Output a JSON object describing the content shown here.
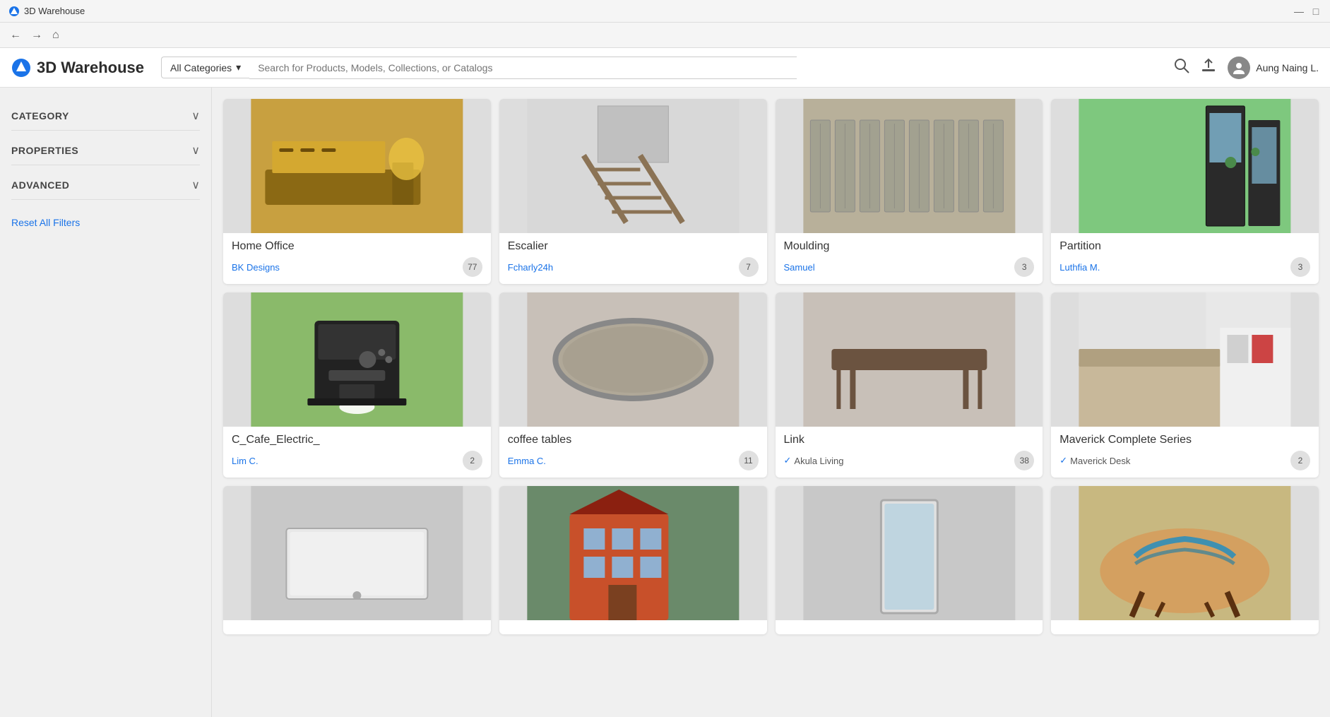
{
  "titleBar": {
    "title": "3D Warehouse",
    "minBtn": "—",
    "maxBtn": "□"
  },
  "nav": {
    "backBtn": "←",
    "forwardBtn": "→",
    "homeBtn": "⌂"
  },
  "header": {
    "logoText": "3D Warehouse",
    "categoryDropdown": "All Categories",
    "searchPlaceholder": "Search for Products, Models, Collections, or Catalogs",
    "userName": "Aung Naing L."
  },
  "sidebar": {
    "filters": [
      {
        "id": "category",
        "label": "CATEGORY"
      },
      {
        "id": "properties",
        "label": "PROPERTIES"
      },
      {
        "id": "advanced",
        "label": "ADVANCED"
      }
    ],
    "resetLabel": "Reset All Filters"
  },
  "grid": {
    "cards": [
      {
        "id": "home-office",
        "title": "Home Office",
        "author": "BK Designs",
        "count": "77",
        "verified": false,
        "verifiedText": "",
        "bgColor": "#c8a040",
        "imageType": "desk"
      },
      {
        "id": "escalier",
        "title": "Escalier",
        "author": "Fcharly24h",
        "count": "7",
        "verified": false,
        "verifiedText": "",
        "bgColor": "#d0d0d0",
        "imageType": "ladder"
      },
      {
        "id": "moulding",
        "title": "Moulding",
        "author": "Samuel",
        "count": "3",
        "verified": false,
        "verifiedText": "",
        "bgColor": "#b8b09a",
        "imageType": "moulding"
      },
      {
        "id": "partition",
        "title": "Partition",
        "author": "Luthfia M.",
        "count": "3",
        "verified": false,
        "verifiedText": "",
        "bgColor": "#7ec87e",
        "imageType": "partition"
      },
      {
        "id": "cafe-electric",
        "title": "C_Cafe_Electric_",
        "author": "Lim C.",
        "count": "2",
        "verified": false,
        "verifiedText": "",
        "bgColor": "#8aba6a",
        "imageType": "coffee-machine"
      },
      {
        "id": "coffee-tables",
        "title": "coffee tables",
        "author": "Emma C.",
        "count": "11",
        "verified": false,
        "verifiedText": "",
        "bgColor": "#c8c0b8",
        "imageType": "round-table"
      },
      {
        "id": "link",
        "title": "Link",
        "author": "Akula Living",
        "count": "38",
        "verified": true,
        "verifiedText": "Akula Living",
        "bgColor": "#c8c0b8",
        "imageType": "dining-table"
      },
      {
        "id": "maverick",
        "title": "Maverick Complete Series",
        "author": "Maverick Desk",
        "count": "2",
        "verified": true,
        "verifiedText": "Maverick Desk",
        "bgColor": "#e8e8e8",
        "imageType": "reception"
      },
      {
        "id": "shower",
        "title": "",
        "author": "",
        "count": "",
        "verified": false,
        "verifiedText": "",
        "bgColor": "#c0c0c0",
        "imageType": "shower-tray"
      },
      {
        "id": "building",
        "title": "",
        "author": "",
        "count": "",
        "verified": false,
        "verifiedText": "",
        "bgColor": "#6a8a6a",
        "imageType": "building"
      },
      {
        "id": "mirror",
        "title": "",
        "author": "",
        "count": "",
        "verified": false,
        "verifiedText": "",
        "bgColor": "#c8c8c8",
        "imageType": "mirror"
      },
      {
        "id": "wood-table",
        "title": "",
        "author": "",
        "count": "",
        "verified": false,
        "verifiedText": "",
        "bgColor": "#c8b880",
        "imageType": "wood-table"
      }
    ]
  }
}
